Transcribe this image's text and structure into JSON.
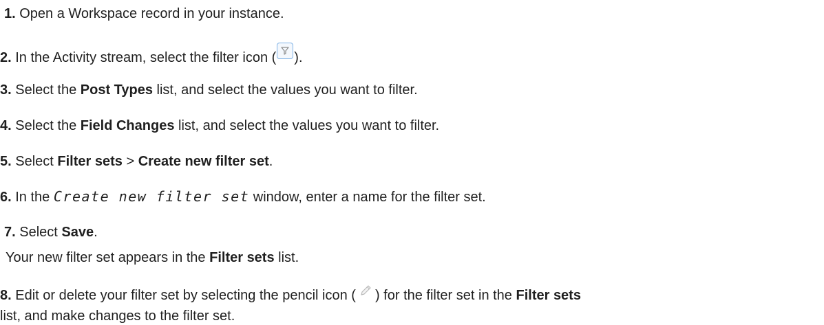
{
  "steps": [
    {
      "number": "1.",
      "text_before": "Open a Workspace record in your instance."
    },
    {
      "number": "2.",
      "text_before": "In the Activity stream, select the filter icon (",
      "icon": "filter-icon",
      "text_after": ")."
    },
    {
      "number": "3.",
      "text_before": "Select the ",
      "bold": "Post Types",
      "text_after": " list, and select the values you want to filter."
    },
    {
      "number": "4.",
      "text_before": "Select the ",
      "bold": "Field Changes",
      "text_after": " list, and select the values you want to filter."
    },
    {
      "number": "5.",
      "text_before": "Select ",
      "bold": "Filter sets",
      "middle": " > ",
      "bold2": "Create new filter set",
      "text_after": "."
    },
    {
      "number": "6.",
      "text_before": "In the ",
      "code": "Create new filter set",
      "text_after": " window, enter a name for the filter set."
    },
    {
      "number": "7.",
      "text_before": "Select ",
      "bold": "Save",
      "text_after": ".",
      "line2_before": "Your new filter set appears in the ",
      "line2_bold": "Filter sets",
      "line2_after": " list."
    },
    {
      "number": "8.",
      "text_before": "Edit or delete your filter set by selecting the pencil icon (",
      "icon": "pencil-icon",
      "text_mid": ") for the filter set in the ",
      "bold": "Filter sets",
      "line2_before": "list, and make changes to the filter set."
    }
  ],
  "colors": {
    "text": "#1f1f1f",
    "icon_border": "#7fb2e6"
  }
}
